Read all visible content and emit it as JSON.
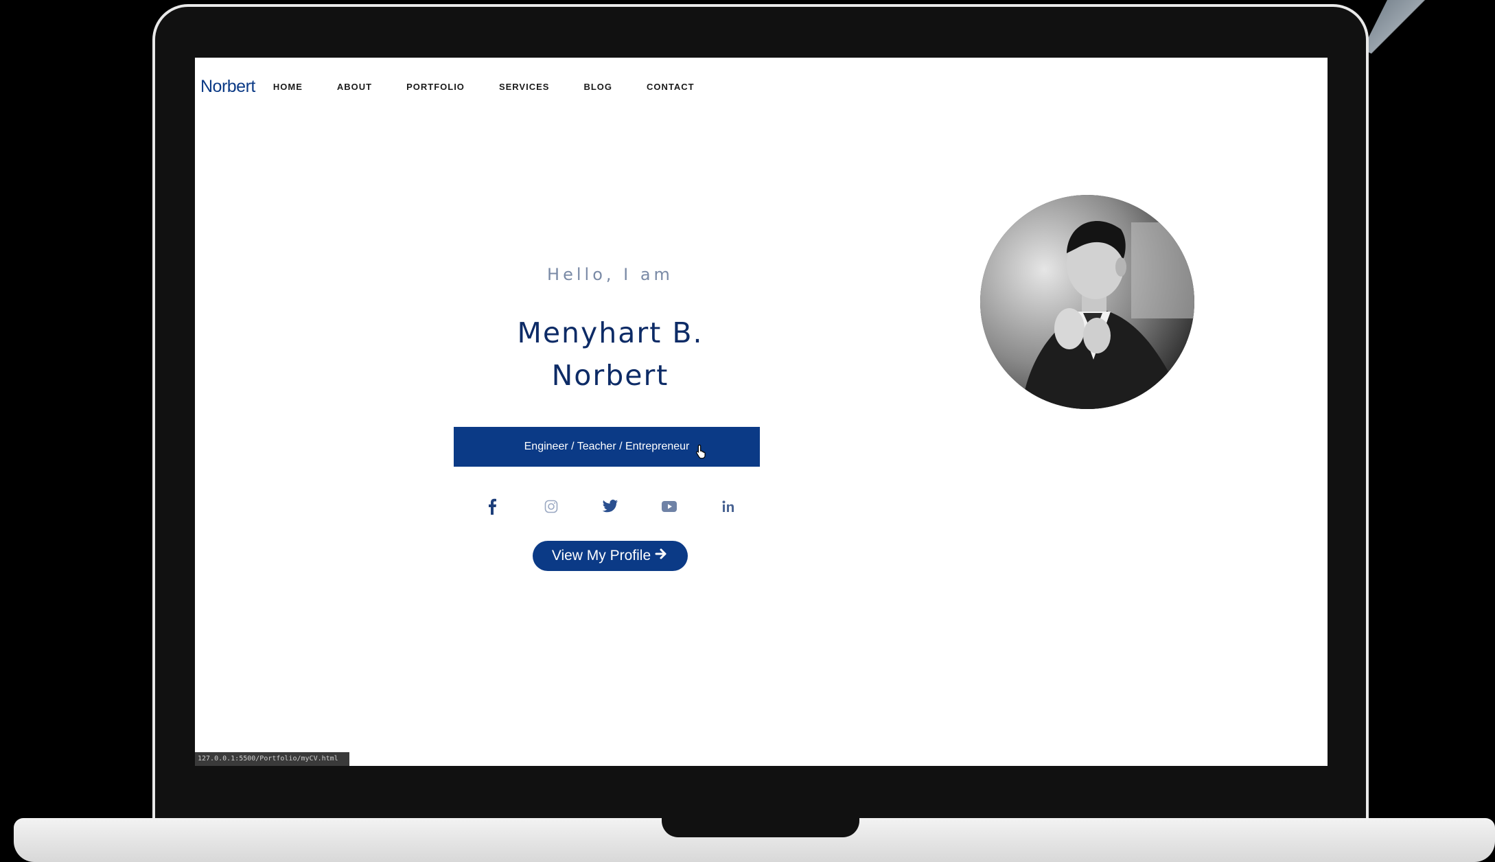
{
  "nav": {
    "logo": "Norbert",
    "links": [
      "HOME",
      "ABOUT",
      "PORTFOLIO",
      "SERVICES",
      "BLOG",
      "CONTACT"
    ]
  },
  "hero": {
    "greeting": "Hello, I am",
    "name_line1": "Menyhart B.",
    "name_line2": "Norbert",
    "roles": "Engineer / Teacher / Entrepreneur",
    "cta_label": "View My Profile",
    "cta_icon": "arrow-right-icon"
  },
  "socials": [
    {
      "name": "facebook-icon"
    },
    {
      "name": "instagram-icon"
    },
    {
      "name": "twitter-icon"
    },
    {
      "name": "youtube-icon"
    },
    {
      "name": "linkedin-icon"
    }
  ],
  "statusbar": {
    "url": "127.0.0.1:5500/Portfolio/myCV.html"
  },
  "colors": {
    "brand": "#0b3a86",
    "heading": "#0d2b66",
    "muted": "#7a8aa6"
  }
}
